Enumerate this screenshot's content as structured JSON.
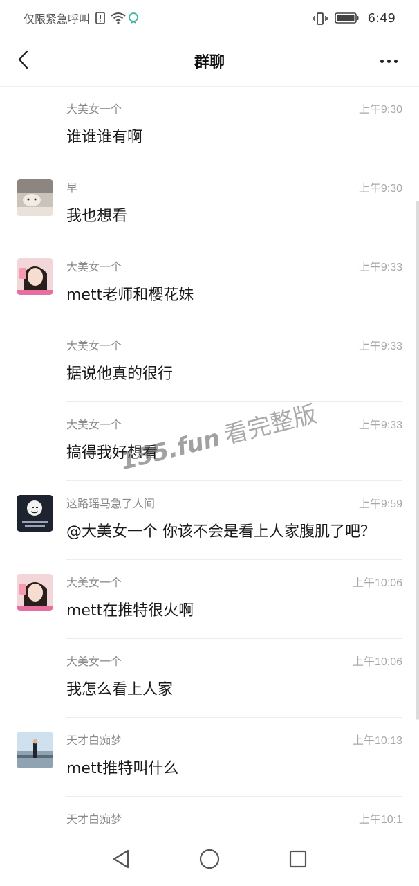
{
  "status_bar": {
    "carrier": "仅限紧急呼叫",
    "time": "6:49",
    "icons": [
      "sim-alert-icon",
      "wifi-icon",
      "msg-icon",
      "vibrate-icon",
      "battery-icon"
    ]
  },
  "header": {
    "title": "群聊",
    "back_icon": "chevron-left-icon",
    "more_icon": "more-horizontal-icon"
  },
  "messages": [
    {
      "sender": "大美女一个",
      "time": "上午9:30",
      "text": "谁谁谁有啊",
      "avatar": ""
    },
    {
      "sender": "早",
      "time": "上午9:30",
      "text": "我也想看",
      "avatar": "cat-photo"
    },
    {
      "sender": "大美女一个",
      "time": "上午9:33",
      "text": "mett老师和樱花妹",
      "avatar": "girl-photo"
    },
    {
      "sender": "大美女一个",
      "time": "上午9:33",
      "text": "据说他真的很行",
      "avatar": ""
    },
    {
      "sender": "大美女一个",
      "time": "上午9:33",
      "text": "搞得我好想看",
      "avatar": ""
    },
    {
      "sender": "这路瑶马急了人间",
      "time": "上午9:59",
      "text": "@大美女一个 你该不会是看上人家腹肌了吧？",
      "avatar": "meme-face"
    },
    {
      "sender": "大美女一个",
      "time": "上午10:06",
      "text": "mett在推特很火啊",
      "avatar": "girl-photo"
    },
    {
      "sender": "大美女一个",
      "time": "上午10:06",
      "text": "我怎么看上人家",
      "avatar": ""
    },
    {
      "sender": "天才白痴梦",
      "time": "上午10:13",
      "text": "mett推特叫什么",
      "avatar": "man-photo"
    },
    {
      "sender": "天才白痴梦",
      "time": "上午10:1",
      "text": "",
      "avatar": ""
    }
  ],
  "watermark": {
    "site": "155.fun",
    "suffix": "看完整版"
  },
  "nav_bar": {
    "icons": [
      "back-triangle-icon",
      "home-circle-icon",
      "recents-square-icon"
    ]
  },
  "colors": {
    "text_primary": "#1a1a1a",
    "text_secondary": "#8a8a8a",
    "time_text": "#a8a8a8",
    "divider": "#ececec"
  }
}
